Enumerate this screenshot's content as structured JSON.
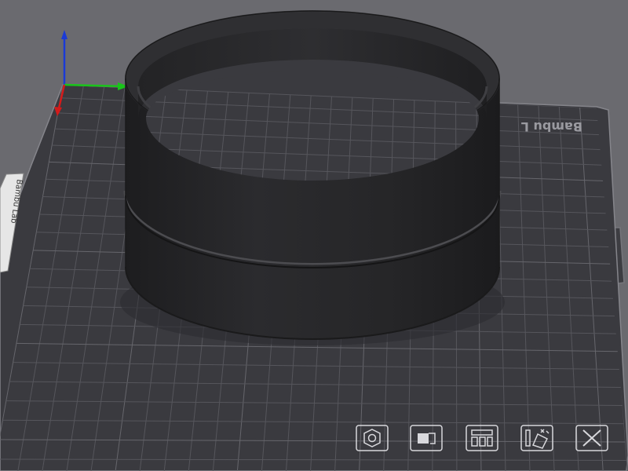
{
  "viewport": {
    "background_color": "#6a6a6f",
    "plate": {
      "brand_text": "Bambu L",
      "side_label": "Bambu Lab",
      "surface_color": "#3a3a3f",
      "grid_color": "#5c5c62"
    },
    "axes": {
      "x_color": "#19c41a",
      "y_color": "#d41a1a",
      "z_color": "#1a3ad6"
    },
    "model": {
      "name": "cylindrical-ring",
      "color": "#262628"
    }
  },
  "toolbar": {
    "items": [
      {
        "id": "orient",
        "icon": "hexagon-nut-icon"
      },
      {
        "id": "bed",
        "icon": "plate-icon"
      },
      {
        "id": "arrange",
        "icon": "arrange-icon"
      },
      {
        "id": "edit",
        "icon": "edit-tools-icon"
      },
      {
        "id": "close",
        "icon": "close-icon"
      }
    ],
    "icon_color": "#d8d8dc"
  }
}
